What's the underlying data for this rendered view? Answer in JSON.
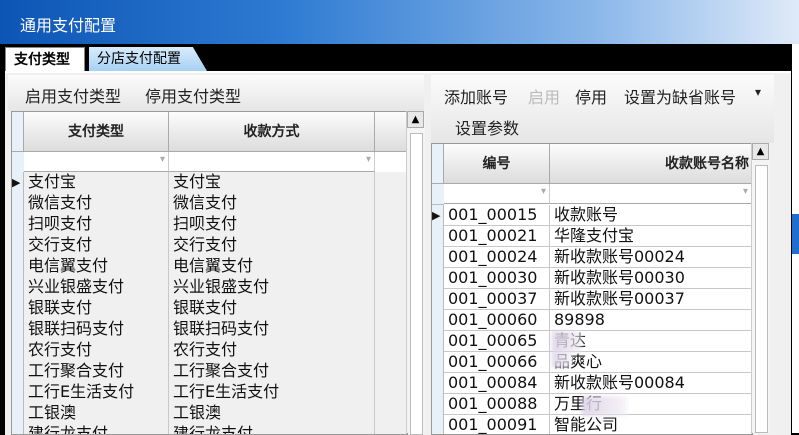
{
  "window": {
    "title": "通用支付配置"
  },
  "tabs": [
    {
      "label": "支付类型"
    },
    {
      "label": "分店支付配置"
    }
  ],
  "left_toolbar": {
    "enable_label": "启用支付类型",
    "disable_label": "停用支付类型"
  },
  "left_grid": {
    "columns": [
      "支付类型",
      "收款方式"
    ],
    "rows": [
      [
        "支付宝",
        "支付宝"
      ],
      [
        "微信支付",
        "微信支付"
      ],
      [
        "扫呗支付",
        "扫呗支付"
      ],
      [
        "交行支付",
        "交行支付"
      ],
      [
        "电信翼支付",
        "电信翼支付"
      ],
      [
        "兴业银盛支付",
        "兴业银盛支付"
      ],
      [
        "银联支付",
        "银联支付"
      ],
      [
        "银联扫码支付",
        "银联扫码支付"
      ],
      [
        "农行支付",
        "农行支付"
      ],
      [
        "工行聚合支付",
        "工行聚合支付"
      ],
      [
        "工行E生活支付",
        "工行E生活支付"
      ],
      [
        "工银澳",
        "工银澳"
      ],
      [
        "建行龙支付",
        "建行龙支付"
      ]
    ]
  },
  "right_toolbar": {
    "add_label": "添加账号",
    "enable_label": "启用",
    "disable_label": "停用",
    "default_label": "设置为缺省账号",
    "params_label": "设置参数"
  },
  "right_grid": {
    "columns": [
      "编号",
      "收款账号名称"
    ],
    "rows": [
      [
        "001_00015",
        "收款账号"
      ],
      [
        "001_00021",
        "华隆支付宝"
      ],
      [
        "001_00024",
        "新收款账号00024"
      ],
      [
        "001_00030",
        "新收款账号00030"
      ],
      [
        "001_00037",
        "新收款账号00037"
      ],
      [
        "001_00060",
        "89898"
      ],
      [
        "001_00065",
        "青达"
      ],
      [
        "001_00066",
        "品爽心"
      ],
      [
        "001_00084",
        "新收款账号00084"
      ],
      [
        "001_00088",
        "万里行"
      ],
      [
        "001_00091",
        "智能公司"
      ]
    ]
  }
}
